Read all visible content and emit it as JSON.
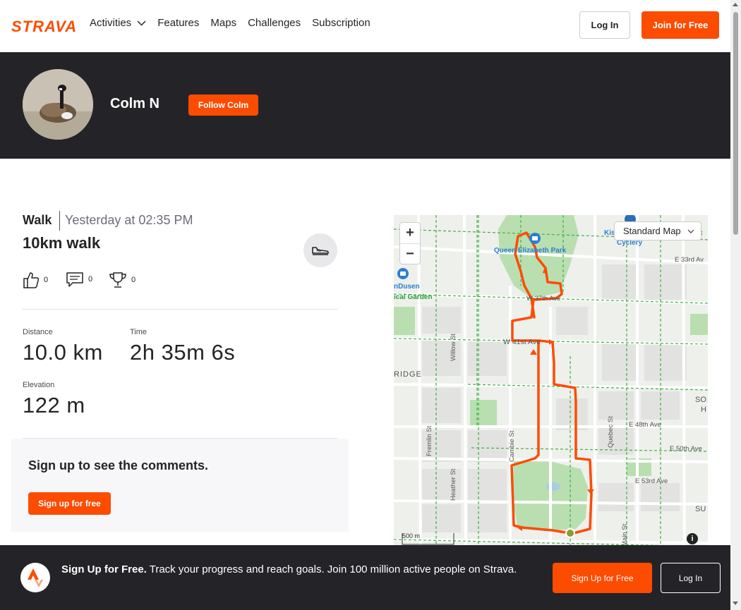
{
  "brand": {
    "name": "STRAVA",
    "accent_color": "#fc4c02",
    "dark_color": "#242428"
  },
  "nav": {
    "items": [
      {
        "label": "Activities",
        "has_dropdown": true
      },
      {
        "label": "Features"
      },
      {
        "label": "Maps"
      },
      {
        "label": "Challenges"
      },
      {
        "label": "Subscription"
      }
    ],
    "login_label": "Log In",
    "join_label": "Join for Free"
  },
  "athlete": {
    "name": "Colm N",
    "follow_label": "Follow Colm",
    "avatar_icon": "goose-photo"
  },
  "activity": {
    "type": "Walk",
    "date": "Yesterday at 02:35 PM",
    "title": "10km walk",
    "sport_icon": "shoe-icon",
    "kudos": "0",
    "comments": "0",
    "achievements": "0",
    "stats": {
      "distance_label": "Distance",
      "distance_value": "10.0 km",
      "time_label": "Time",
      "time_value": "2h 35m 6s",
      "elevation_label": "Elevation",
      "elevation_value": "122 m"
    }
  },
  "comments_panel": {
    "text": "Sign up to see the comments.",
    "button_label": "Sign up for free"
  },
  "map": {
    "zoom_in": "+",
    "zoom_out": "−",
    "style_select": "Standard Map",
    "scale_label": "500 m",
    "info": "i",
    "labels": {
      "park1": "Queen Elizabeth Park",
      "garden_a": "nDusen",
      "garden_b": "ical Garden",
      "ave37": "W 37th Ave",
      "ave41": "W 41st Ave",
      "ave33": "E 33rd Av",
      "ave48": "E 48th Ave",
      "ave50": "E 50th Ave",
      "ave53": "E 53rd Ave",
      "willow": "Willow St",
      "fremlin": "Fremlin St",
      "heather": "Heather St",
      "cambie": "Cambie St",
      "quebec": "Quebec St",
      "main": "Main St",
      "ridge": "RIDGE",
      "kis": "Kis",
      "cyclery": "Cyclery",
      "so": "SO",
      "h": "H",
      "su": "SU",
      "st": "st"
    }
  },
  "banner": {
    "bold": "Sign Up for Free.",
    "text": " Track your progress and reach goals. Join 100 million active people on Strava.",
    "signup_label": "Sign Up for Free",
    "login_label": "Log In"
  }
}
